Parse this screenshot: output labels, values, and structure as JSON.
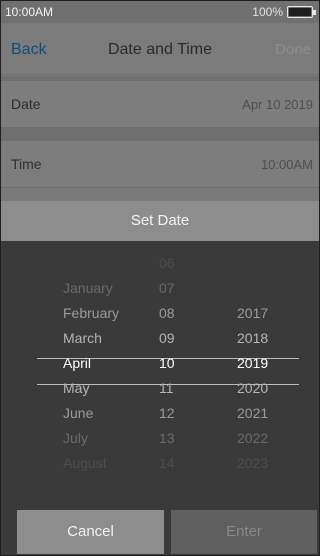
{
  "status_bar": {
    "time": "10:00AM",
    "battery": "100%"
  },
  "nav": {
    "back": "Back",
    "title": "Date and Time",
    "done": "Done"
  },
  "rows": {
    "date": {
      "label": "Date",
      "value": "Apr 10 2019"
    },
    "time": {
      "label": "Time",
      "value": "10:00AM"
    }
  },
  "sheet": {
    "title": "Set Date",
    "months": [
      "",
      "January",
      "February",
      "March",
      "April",
      "May",
      "June",
      "July",
      "August"
    ],
    "days": [
      "06",
      "07",
      "08",
      "09",
      "10",
      "11",
      "12",
      "13",
      "14"
    ],
    "years": [
      "",
      "",
      "2017",
      "2018",
      "2019",
      "2020",
      "2021",
      "2022",
      "2023"
    ],
    "selected_index": 4,
    "cancel": "Cancel",
    "enter": "Enter"
  },
  "colors": {
    "back_link": "#0c4f7f",
    "picker_bg": "#3a3a3a",
    "header_bg": "#8d8d8d"
  }
}
